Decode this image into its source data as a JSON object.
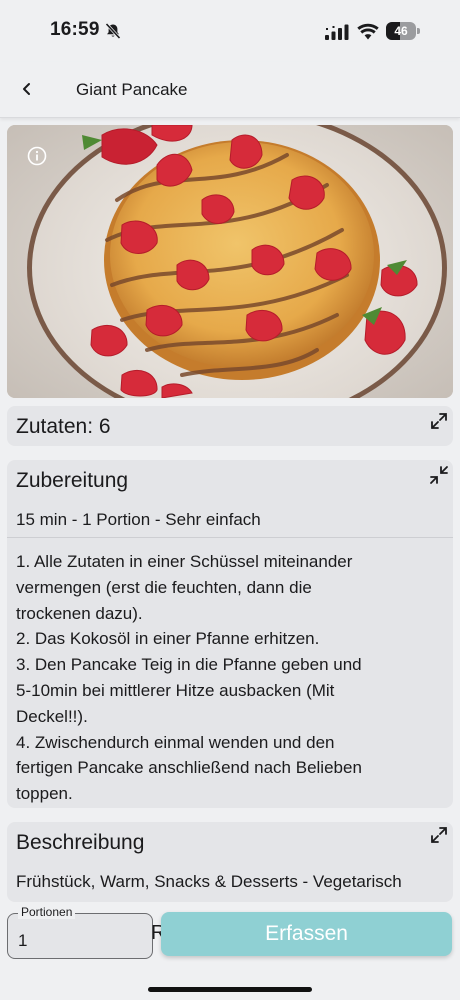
{
  "status_bar": {
    "time": "16:59",
    "battery": "46",
    "battery_level": 0.46
  },
  "header": {
    "title": "Giant Pancake"
  },
  "hero": {
    "image": "pancake-with-strawberries-photo"
  },
  "ingredients": {
    "title": "Zutaten: 6",
    "icon": "expand-icon"
  },
  "preparation": {
    "title": "Zubereitung",
    "meta": "15 min - 1 Portion - Sehr einfach",
    "icon": "collapse-icon",
    "lines": [
      "1. Alle Zutaten in einer Schüssel miteinander",
      "vermengen (erst die feuchten, dann die",
      "trockenen dazu).",
      "2. Das Kokosöl in einer Pfanne erhitzen.",
      "3. Den Pancake Teig in die Pfanne geben und",
      "5-10min bei mittlerer Hitze ausbacken (Mit",
      "Deckel!!).",
      "4. Zwischendurch einmal wenden und den",
      "fertigen Pancake anschließend nach Belieben",
      "toppen."
    ]
  },
  "description": {
    "title": "Beschreibung",
    "tags": "Frühstück, Warm, Snacks & Desserts - Vegetarisch",
    "icon": "expand-icon"
  },
  "bottom": {
    "portions_label": "Portionen",
    "portions_value": "1",
    "partial_text": "R",
    "submit_label": "Erfassen",
    "submit_color": "#8fd0d3"
  }
}
